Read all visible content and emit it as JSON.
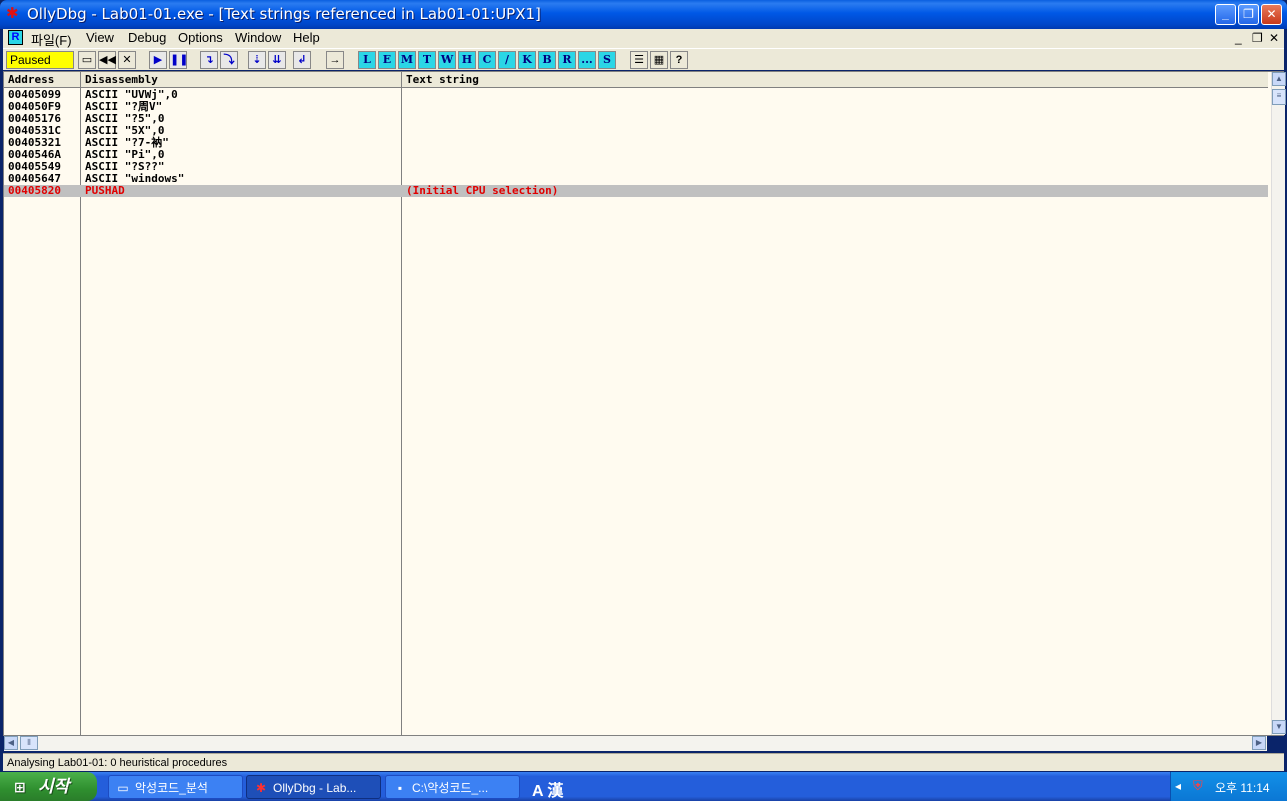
{
  "window": {
    "title": "OllyDbg - Lab01-01.exe - [Text strings referenced in Lab01-01:UPX1]"
  },
  "menu": {
    "items": [
      "파일(F)",
      "View",
      "Debug",
      "Options",
      "Window",
      "Help"
    ],
    "r_icon": "R"
  },
  "toolbar": {
    "status": "Paused",
    "letter_buttons": [
      "L",
      "E",
      "M",
      "T",
      "W",
      "H",
      "C",
      "/",
      "K",
      "B",
      "R",
      "...",
      "S"
    ],
    "help": "?"
  },
  "table": {
    "columns": [
      "Address",
      "Disassembly",
      "Text string"
    ],
    "rows": [
      {
        "address": "00405099",
        "disassembly": "ASCII \"UVWj\",0",
        "text": ""
      },
      {
        "address": "004050F9",
        "disassembly": "ASCII \"?周V\"",
        "text": ""
      },
      {
        "address": "00405176",
        "disassembly": "ASCII \"?5\",0",
        "text": ""
      },
      {
        "address": "0040531C",
        "disassembly": "ASCII \"5X\",0",
        "text": ""
      },
      {
        "address": "00405321",
        "disassembly": "ASCII \"?7-衲\"",
        "text": ""
      },
      {
        "address": "0040546A",
        "disassembly": "ASCII \"Pi\",0",
        "text": ""
      },
      {
        "address": "00405549",
        "disassembly": "ASCII \"?S??\"",
        "text": ""
      },
      {
        "address": "00405647",
        "disassembly": "ASCII \"windows\"",
        "text": ""
      },
      {
        "address": "00405820",
        "disassembly": "PUSHAD",
        "text": "(Initial CPU selection)"
      }
    ],
    "selected_row": 8
  },
  "statusbar": {
    "text": "Analysing Lab01-01: 0 heuristical procedures"
  },
  "taskbar": {
    "start_label": "시작",
    "tasks": [
      {
        "label": "악성코드_분석",
        "icon": "folder-icon"
      },
      {
        "label": "OllyDbg - Lab...",
        "icon": "ollydbg-icon"
      },
      {
        "label": "C:\\악성코드_...",
        "icon": "cmd-icon"
      }
    ],
    "ime": "A 漢",
    "clock": "오후 11:14"
  },
  "colors": {
    "paused": "#ffff00",
    "selected_row_text": "#e00000",
    "panel_bg": "#fffbf0"
  }
}
